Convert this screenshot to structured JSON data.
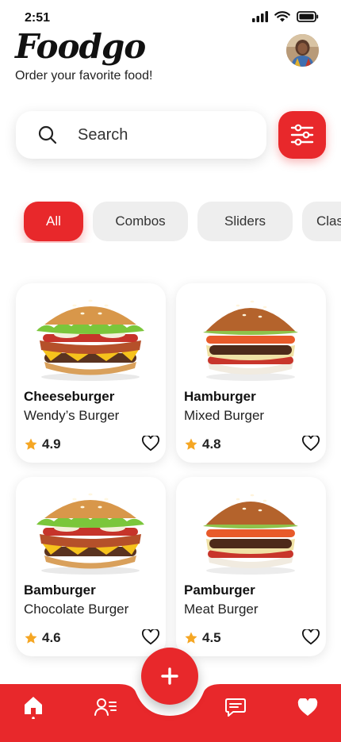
{
  "status_bar": {
    "time": "2:51",
    "icons": [
      "signal-icon",
      "wifi-icon",
      "battery-icon"
    ]
  },
  "header": {
    "title": "Foodgo",
    "subtitle": "Order your favorite food!"
  },
  "search": {
    "placeholder": "Search"
  },
  "categories": [
    {
      "label": "All",
      "active": true
    },
    {
      "label": "Combos",
      "active": false
    },
    {
      "label": "Sliders",
      "active": false
    },
    {
      "label": "Classic",
      "active": false
    }
  ],
  "products": [
    {
      "name": "Cheeseburger",
      "brand": "Wendy’s Burger",
      "rating": "4.9"
    },
    {
      "name": "Hamburger",
      "brand": "Mixed Burger",
      "rating": "4.8"
    },
    {
      "name": "Bamburger",
      "brand": "Chocolate Burger",
      "rating": "4.6"
    },
    {
      "name": "Pamburger",
      "brand": "Meat Burger",
      "rating": "4.5"
    }
  ],
  "bottom_nav": {
    "items": [
      "home-icon",
      "profile-icon",
      "chat-icon",
      "favorites-icon"
    ],
    "fab_icon": "plus-icon"
  },
  "colors": {
    "accent": "#e8282b",
    "chip_bg": "#eeeeee",
    "star": "#f5a623"
  }
}
